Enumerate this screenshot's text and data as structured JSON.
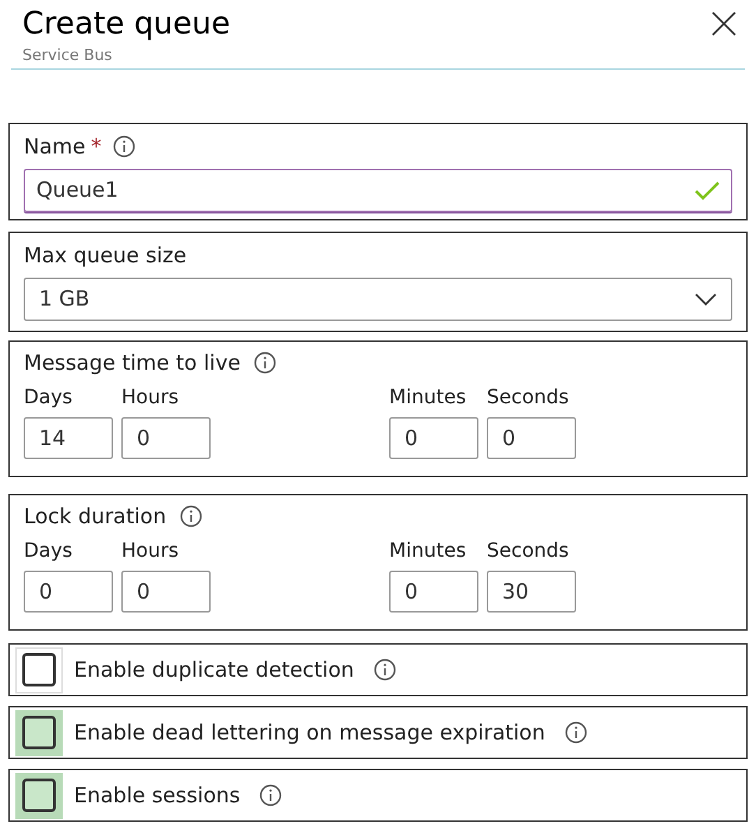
{
  "panel": {
    "title": "Create queue",
    "subtitle": "Service Bus"
  },
  "name_field": {
    "label": "Name",
    "required_mark": "*",
    "value": "Queue1",
    "valid": true
  },
  "max_queue_size": {
    "label": "Max queue size",
    "value": "1 GB"
  },
  "durations": [
    {
      "label": "Message time to live",
      "fields": [
        {
          "label": "Days",
          "value": "14"
        },
        {
          "label": "Hours",
          "value": "0"
        },
        {
          "label": "Minutes",
          "value": "0"
        },
        {
          "label": "Seconds",
          "value": "0"
        }
      ]
    },
    {
      "label": "Lock duration",
      "fields": [
        {
          "label": "Days",
          "value": "0"
        },
        {
          "label": "Hours",
          "value": "0"
        },
        {
          "label": "Minutes",
          "value": "0"
        },
        {
          "label": "Seconds",
          "value": "30"
        }
      ]
    }
  ],
  "options": [
    {
      "label": "Enable duplicate detection",
      "highlighted": false
    },
    {
      "label": "Enable dead lettering on message expiration",
      "highlighted": true
    },
    {
      "label": "Enable sessions",
      "highlighted": true
    }
  ]
}
